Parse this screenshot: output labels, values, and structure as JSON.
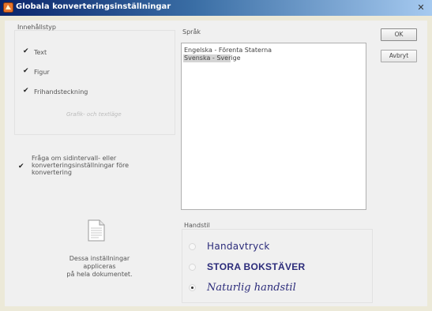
{
  "window": {
    "title": "Globala konverteringsinställningar",
    "close_glyph": "✕"
  },
  "content_type": {
    "label": "Innehållstyp",
    "items": [
      {
        "label": "Text",
        "checked": true
      },
      {
        "label": "Figur",
        "checked": true
      },
      {
        "label": "Frihandsteckning",
        "checked": true
      }
    ],
    "graphics_text_mode": "Grafik- och textläge"
  },
  "ask_option": {
    "label": "Fråga om sidintervall- eller\nkonverteringsinställningar före\nkonvertering",
    "checked": true
  },
  "note": "Dessa inställningar appliceras\npå hela dokumentet.",
  "language": {
    "label": "Språk",
    "options": [
      "Engelska - Förenta Staterna",
      "Svenska - Sverige"
    ],
    "selected": "Svenska - Sverige"
  },
  "handwriting": {
    "label": "Handstil",
    "options": [
      {
        "label": "Handavtryck",
        "checked": false
      },
      {
        "label": "STORA BOKSTÄVER",
        "checked": false
      },
      {
        "label": "Naturlig handstil",
        "checked": true
      }
    ]
  },
  "buttons": {
    "ok": "OK",
    "cancel": "Avbryt"
  },
  "colors": {
    "title_start": "#0a246a",
    "title_end": "#a6caf0",
    "handwriting_ink": "#2b2b7a"
  }
}
